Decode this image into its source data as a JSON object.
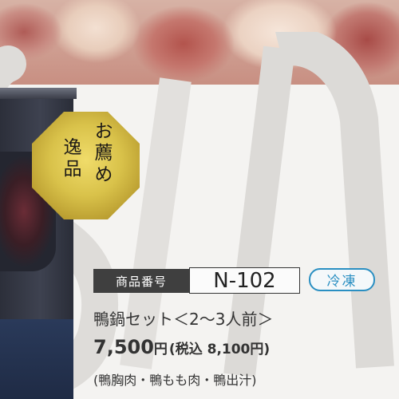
{
  "badge": {
    "col1": "お薦め",
    "col2": "逸品"
  },
  "product": {
    "code_label": "商品番号",
    "code_value": "N-102",
    "storage_tag": "冷凍",
    "name": "鴨鍋セット＜2〜3人前＞",
    "price_value": "7,500",
    "price_yen": "円",
    "price_tax": "(税込 8,100円)",
    "contents": "(鴨胸肉・鴨もも肉・鴨出汁)"
  },
  "colors": {
    "frozen_blue": "#2a8fc2",
    "label_dark": "#3f3f3f",
    "badge_gold": "#d9c24a"
  }
}
